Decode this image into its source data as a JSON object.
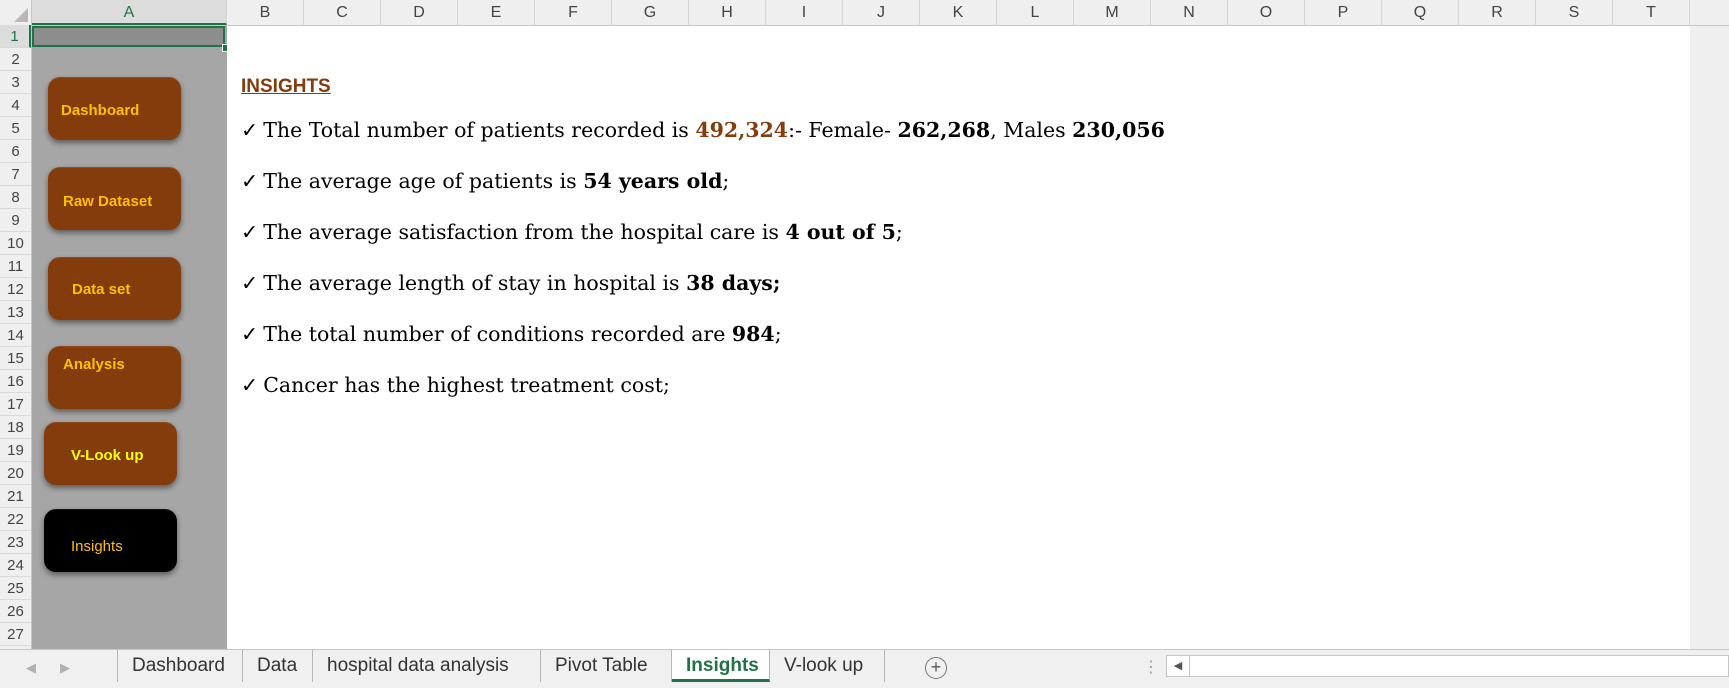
{
  "sheet": {
    "columns": [
      "A",
      "B",
      "C",
      "D",
      "E",
      "F",
      "G",
      "H",
      "I",
      "J",
      "K",
      "L",
      "M",
      "N",
      "O",
      "P",
      "Q",
      "R",
      "S",
      "T"
    ],
    "active_column": "A",
    "rows": [
      "1",
      "2",
      "3",
      "4",
      "5",
      "6",
      "7",
      "8",
      "9",
      "10",
      "11",
      "12",
      "13",
      "14",
      "15",
      "16",
      "17",
      "18",
      "19",
      "20",
      "21",
      "22",
      "23",
      "24",
      "25",
      "26",
      "27"
    ],
    "active_row": "1"
  },
  "sidebar": {
    "buttons": [
      {
        "label": "Dashboard"
      },
      {
        "label": "Raw Dataset"
      },
      {
        "label": "Data set"
      },
      {
        "label": "Analysis"
      },
      {
        "label": "V-Look up"
      },
      {
        "label": "Insights"
      }
    ]
  },
  "insights": {
    "heading": "INSIGHTS",
    "check": "✓",
    "line1": {
      "prefix": "The Total number of patients recorded is ",
      "total": "492,324",
      "mid": ":- Female- ",
      "female": "262,268",
      "sep": ",  Males ",
      "male": "230,056"
    },
    "line2": {
      "prefix": "The average age of patients is ",
      "value": "54 years old",
      "suffix": ";"
    },
    "line3": {
      "prefix": "The average satisfaction from the hospital care is ",
      "value": "4 out of 5",
      "suffix": ";"
    },
    "line4": {
      "prefix": "The average length of stay in hospital is ",
      "value": "38 days;",
      "suffix": ""
    },
    "line5": {
      "prefix": "The total number of conditions recorded are ",
      "value": "984",
      "suffix": ";"
    },
    "line6": {
      "text": "Cancer has the highest treatment cost;"
    }
  },
  "tabs": {
    "items": [
      {
        "label": "Dashboard"
      },
      {
        "label": "Data"
      },
      {
        "label": "hospital data analysis"
      },
      {
        "label": "Pivot Table"
      },
      {
        "label": "Insights"
      },
      {
        "label": "V-look up"
      }
    ],
    "active": "Insights",
    "add_icon": "+"
  },
  "colors": {
    "accent_brown": "#843c0c",
    "button_text": "#ffc000",
    "excel_green": "#217346"
  }
}
